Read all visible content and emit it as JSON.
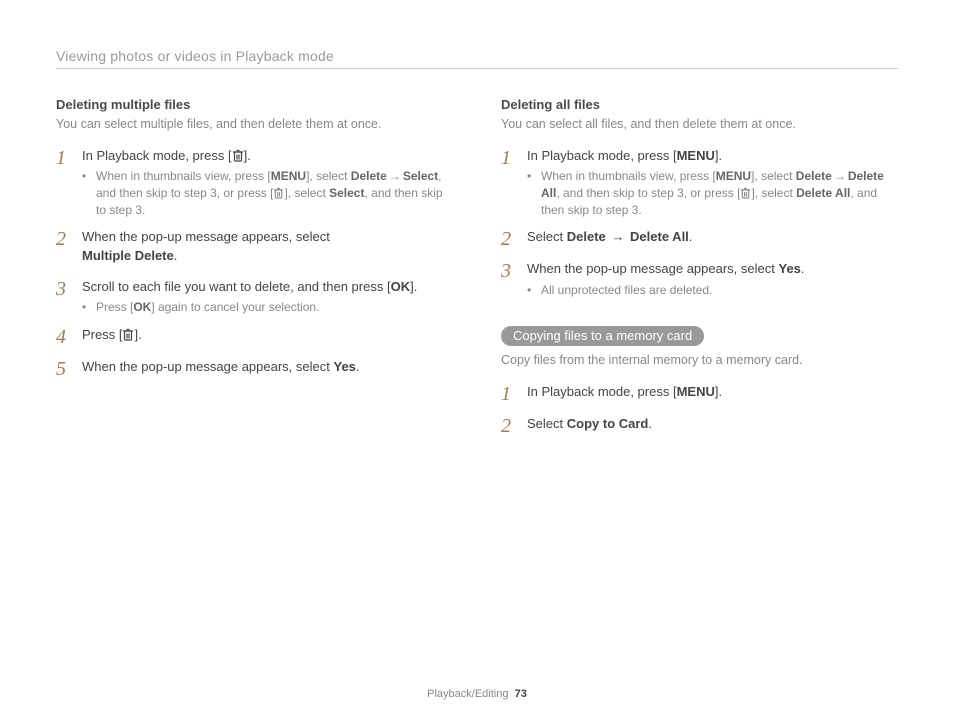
{
  "header": "Viewing photos or videos in Playback mode",
  "footer": {
    "section": "Playback/Editing",
    "page": "73"
  },
  "left": {
    "subhead": "Deleting multiple files",
    "intro": "You can select multiple files, and then delete them at once.",
    "s1": {
      "pre": "In Playback mode, press [",
      "post": "].",
      "b_pre": "When in thumbnails view, press [",
      "b_mid1": "], select ",
      "b_del": "Delete",
      "b_arrow": "→",
      "b_sel": "Select",
      "b_mid2": ", and then skip to step 3, or press [",
      "b_mid3": "], select ",
      "b_sel2": "Select",
      "b_end": ", and then skip to step 3."
    },
    "s2": {
      "line1": "When the pop-up message appears, select",
      "bold": "Multiple Delete",
      "end": "."
    },
    "s3": {
      "line1": "Scroll to each file you want to delete, and then press [",
      "line_end": "].",
      "b_pre": "Press [",
      "b_post": "] again to cancel your selection."
    },
    "s4": {
      "pre": "Press [",
      "post": "]."
    },
    "s5": {
      "pre": "When the pop-up message appears, select ",
      "bold": "Yes",
      "end": "."
    }
  },
  "right": {
    "subhead": "Deleting all files",
    "intro": "You can select all files, and then delete them at once.",
    "s1": {
      "pre": "In Playback mode, press [",
      "post": "].",
      "b_pre": "When in thumbnails view, press [",
      "b_mid1": "], select ",
      "b_del": "Delete",
      "b_arrow": "→",
      "b_da": "Delete All",
      "b_mid2": ", and then skip to step 3, or press [",
      "b_mid3": "], select ",
      "b_da2": "Delete All",
      "b_end": ", and then skip to step 3."
    },
    "s2": {
      "pre": "Select ",
      "b1": "Delete",
      "arrow": "→",
      "b2": "Delete All",
      "end": "."
    },
    "s3": {
      "pre": "When the pop-up message appears, select ",
      "bold": "Yes",
      "end": ".",
      "bline": "All unprotected files are deleted."
    },
    "pill": "Copying files to a memory card",
    "intro2": "Copy files from the internal memory to a memory card.",
    "c1": {
      "pre": "In Playback mode, press [",
      "post": "]."
    },
    "c2": {
      "pre": "Select ",
      "bold": "Copy to Card",
      "end": "."
    }
  },
  "icons": {
    "menu": "MENU",
    "ok": "OK",
    "trash": "trash-icon"
  },
  "nums": {
    "n1": "1",
    "n2": "2",
    "n3": "3",
    "n4": "4",
    "n5": "5"
  }
}
